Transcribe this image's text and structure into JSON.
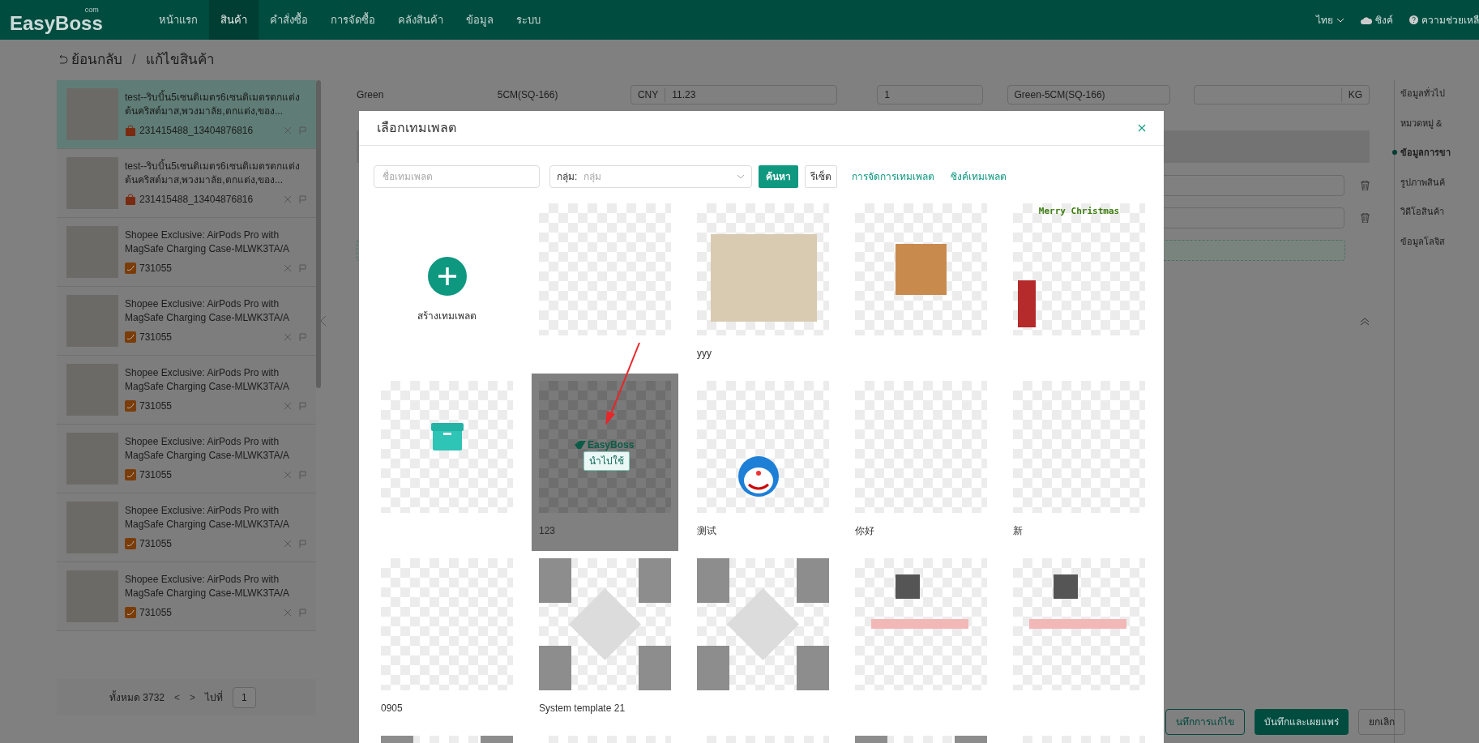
{
  "header": {
    "logo": "EasyBoss",
    "logo_suffix": "com",
    "nav": [
      {
        "label": "หน้าแรก",
        "selected": false
      },
      {
        "label": "สินค้า",
        "selected": true
      },
      {
        "label": "คำสั่งซื้อ",
        "selected": false
      },
      {
        "label": "การจัดซื้อ",
        "selected": false
      },
      {
        "label": "คลังสินค้า",
        "selected": false
      },
      {
        "label": "ข้อมูล",
        "selected": false
      },
      {
        "label": "ระบบ",
        "selected": false
      }
    ],
    "language": "ไทย",
    "sync": "ซิงค์",
    "help": "ความช่วยเหลื"
  },
  "breadcrumb": {
    "back": "ย้อนกลับ",
    "separator": "/",
    "current": "แก้ไขสินค้า"
  },
  "product_list": {
    "items": [
      {
        "title": "test--ริบบิ้น5เซนติเมตร6เซนติเมตรตกแต่งต้นคริสต์มาส,พวงมาลัย,ตกแต่ง,ของ...",
        "code": "231415488_13404876816",
        "kind": "shopee",
        "selected": true
      },
      {
        "title": "test--ริบบิ้น5เซนติเมตร6เซนติเมตรตกแต่งต้นคริสต์มาส,พวงมาลัย,ตกแต่ง,ของ...",
        "code": "231415488_13404876816",
        "kind": "shopee",
        "selected": false
      },
      {
        "title": "Shopee Exclusive: AirPods Pro with MagSafe Charging Case-MLWK3TA/A",
        "code": "731055",
        "kind": "alibaba",
        "selected": false
      },
      {
        "title": "Shopee Exclusive: AirPods Pro with MagSafe Charging Case-MLWK3TA/A",
        "code": "731055",
        "kind": "alibaba",
        "selected": false
      },
      {
        "title": "Shopee Exclusive: AirPods Pro with MagSafe Charging Case-MLWK3TA/A",
        "code": "731055",
        "kind": "alibaba",
        "selected": false
      },
      {
        "title": "Shopee Exclusive: AirPods Pro with MagSafe Charging Case-MLWK3TA/A",
        "code": "731055",
        "kind": "alibaba",
        "selected": false
      },
      {
        "title": "Shopee Exclusive: AirPods Pro with MagSafe Charging Case-MLWK3TA/A",
        "code": "731055",
        "kind": "alibaba",
        "selected": false
      },
      {
        "title": "Shopee Exclusive: AirPods Pro with MagSafe Charging Case-MLWK3TA/A",
        "code": "731055",
        "kind": "alibaba",
        "selected": false
      }
    ],
    "pagination": {
      "total": "ทั้งหมด 3732",
      "prev": "<",
      "next": ">",
      "goto": "ไปที่",
      "page": "1"
    }
  },
  "variant_row": {
    "option": "Green",
    "size": "5CM(SQ-166)",
    "currency": "CNY",
    "price": "11.23",
    "quantity": "1",
    "sku": "Green-5CM(SQ-166)",
    "unit": "KG"
  },
  "section_nav": [
    {
      "label": "ข้อมูลทั่วไป",
      "selected": false
    },
    {
      "label": "หมวดหมู่ &",
      "selected": false
    },
    {
      "label": "ข้อมูลการขา",
      "selected": true
    },
    {
      "label": "รูปภาพสินค้",
      "selected": false
    },
    {
      "label": "วิดีโอสินค้า",
      "selected": false
    },
    {
      "label": "ข้อมูลโลจิส",
      "selected": false
    }
  ],
  "footer_buttons": [
    {
      "label": "นทึกการแก้ไข",
      "kind": "outline"
    },
    {
      "label": "บันทึกและเผยแพร่",
      "kind": "primary"
    },
    {
      "label": "ยกเลิก",
      "kind": "plain"
    }
  ],
  "modal": {
    "title": "เลือกเทมเพลต",
    "search": {
      "placeholder": "ชื่อเทมเพลต"
    },
    "group": {
      "label": "กลุ่ม:",
      "placeholder": "กลุ่ม"
    },
    "search_button": "ค้นหา",
    "reset_button": "รีเซ็ต",
    "links": [
      "การจัดการเทมเพลต",
      "ซิงค์เทมเพลต"
    ],
    "create": "สร้างเทมเพลต",
    "templates": [
      {
        "kind": "blank",
        "hovered": false
      },
      {
        "kind": "photo",
        "label": "yyy",
        "hovered": false
      },
      {
        "kind": "thumbnail",
        "hovered": false
      },
      {
        "kind": "banner",
        "caption": "Merry Christmas",
        "hovered": false
      },
      {
        "kind": "box",
        "hovered": false
      },
      {
        "kind": "logo",
        "logo_text": "EasyBoss",
        "label": "123",
        "hovered": true,
        "action": "นำไปใช้"
      },
      {
        "kind": "cartoon",
        "label": "测试",
        "hovered": false
      },
      {
        "kind": "blank",
        "label": "你好",
        "hovered": false
      },
      {
        "kind": "blank",
        "label": "新",
        "hovered": false
      },
      {
        "kind": "blank",
        "label": "0905",
        "hovered": false
      },
      {
        "kind": "collage",
        "label": "System template 21",
        "hovered": false
      },
      {
        "kind": "collage",
        "hovered": false
      },
      {
        "kind": "mosaic",
        "hovered": false
      },
      {
        "kind": "mosaic",
        "hovered": false
      },
      {
        "kind": "collage",
        "hovered": false
      },
      {
        "kind": "blank",
        "hovered": false
      },
      {
        "kind": "blank",
        "hovered": false
      },
      {
        "kind": "collage",
        "hovered": false
      },
      {
        "kind": "blank",
        "hovered": false
      }
    ]
  }
}
